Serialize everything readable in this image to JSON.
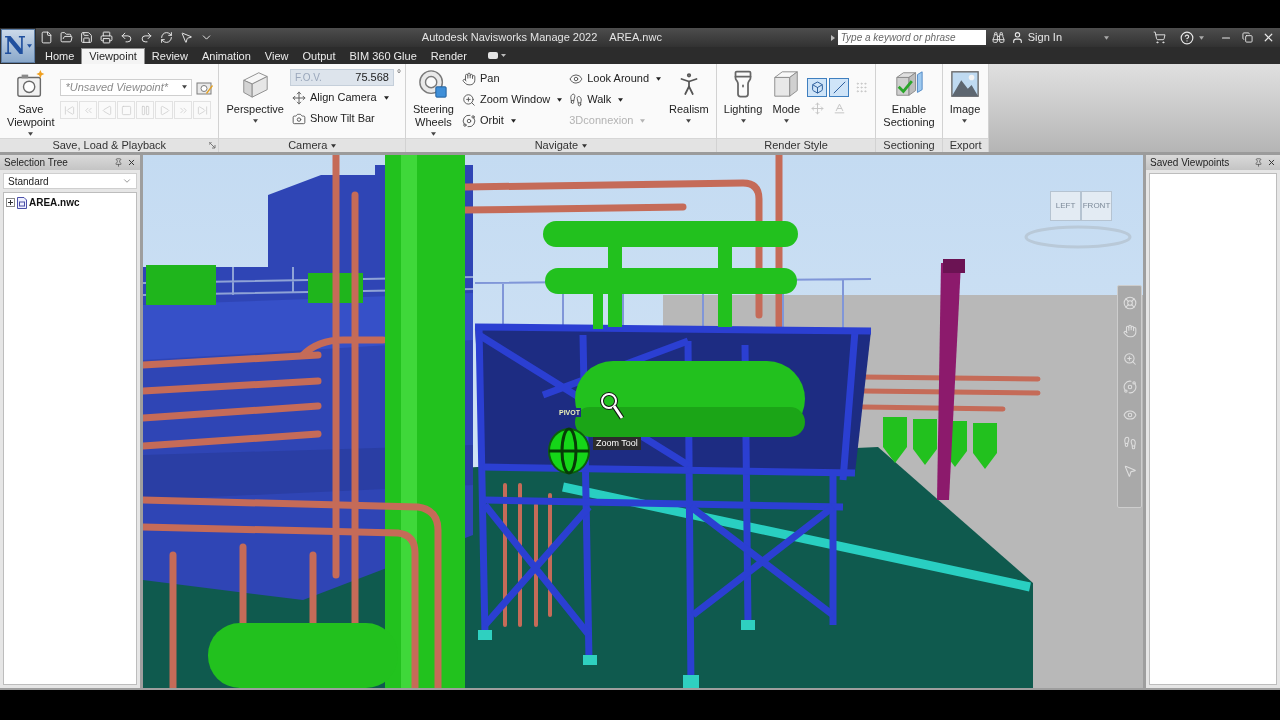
{
  "title_bar": {
    "logo": "N",
    "title": "Autodesk Navisworks Manage 2022",
    "file": "AREA.nwc",
    "search": {
      "placeholder": "Type a keyword or phrase"
    },
    "sign_in": "Sign In"
  },
  "tabs": [
    {
      "label": "Home",
      "selected": false
    },
    {
      "label": "Viewpoint",
      "selected": true
    },
    {
      "label": "Review",
      "selected": false
    },
    {
      "label": "Animation",
      "selected": false
    },
    {
      "label": "View",
      "selected": false
    },
    {
      "label": "Output",
      "selected": false
    },
    {
      "label": "BIM 360 Glue",
      "selected": false
    },
    {
      "label": "Render",
      "selected": false
    }
  ],
  "ribbon": {
    "panels": [
      {
        "label": "Save, Load & Playback",
        "launcher": true,
        "items": [
          {
            "kind": "large",
            "label": "Save Viewpoint",
            "menu": true
          },
          {
            "kind": "viewpoints",
            "value": "*Unsaved Viewpoint*",
            "playback": [
              {
                "disabled": true
              },
              {
                "disabled": true
              },
              {
                "disabled": true
              },
              {
                "disabled": true
              },
              {
                "disabled": true
              },
              {
                "disabled": true
              },
              {
                "disabled": true
              },
              {
                "disabled": true
              }
            ]
          }
        ]
      },
      {
        "label": "Camera",
        "menu": true,
        "items": [
          {
            "kind": "large",
            "label": "Perspective",
            "menu": true
          },
          {
            "kind": "column",
            "items": [
              {
                "kind": "field",
                "label": "F.O.V.",
                "value": "75.568",
                "unit": "°"
              },
              {
                "kind": "small",
                "label": "Align Camera",
                "menu": true,
                "disabled": false
              },
              {
                "kind": "small",
                "label": "Show Tilt Bar",
                "menu": false,
                "disabled": false
              }
            ]
          }
        ]
      },
      {
        "label": "Navigate",
        "menu": true,
        "items": [
          {
            "kind": "large",
            "label": "Steering Wheels",
            "menu": true
          },
          {
            "kind": "column",
            "items": [
              {
                "kind": "small",
                "label": "Pan",
                "menu": false,
                "disabled": false
              },
              {
                "kind": "small",
                "label": "Zoom Window",
                "menu": true,
                "disabled": false
              },
              {
                "kind": "small",
                "label": "Orbit",
                "menu": true,
                "disabled": false
              }
            ]
          },
          {
            "kind": "column",
            "items": [
              {
                "kind": "small",
                "label": "Look Around",
                "menu": true,
                "disabled": false
              },
              {
                "kind": "small",
                "label": "Walk",
                "menu": true,
                "disabled": false
              },
              {
                "kind": "small",
                "label": "3Dconnexion",
                "menu": true,
                "disabled": true
              }
            ]
          },
          {
            "kind": "large",
            "label": "Realism",
            "menu": true
          }
        ]
      },
      {
        "label": "Render Style",
        "items": [
          {
            "kind": "large",
            "label": "Lighting",
            "menu": true
          },
          {
            "kind": "large",
            "label": "Mode",
            "menu": true
          },
          {
            "kind": "toggles",
            "items": [
              {
                "selected": true,
                "disabled": false
              },
              {
                "selected": true,
                "disabled": false
              },
              {
                "selected": false,
                "disabled": true
              },
              {
                "selected": false,
                "disabled": true
              },
              {
                "selected": false,
                "disabled": true
              }
            ]
          }
        ]
      },
      {
        "label": "Sectioning",
        "items": [
          {
            "kind": "large",
            "label": "Enable Sectioning",
            "menu": false
          }
        ]
      },
      {
        "label": "Export",
        "items": [
          {
            "kind": "large",
            "label": "Image",
            "menu": true
          }
        ]
      }
    ]
  },
  "selection_tree": {
    "title": "Selection Tree",
    "view": "Standard",
    "items": [
      {
        "label": "AREA.nwc",
        "expanded": false
      }
    ]
  },
  "viewport": {
    "viewcube": [
      {
        "label": "LEFT"
      },
      {
        "label": "FRONT"
      }
    ],
    "pivot": "PIVOT",
    "tooltip": "Zoom Tool"
  },
  "saved_viewpoints": {
    "title": "Saved Viewpoints"
  }
}
